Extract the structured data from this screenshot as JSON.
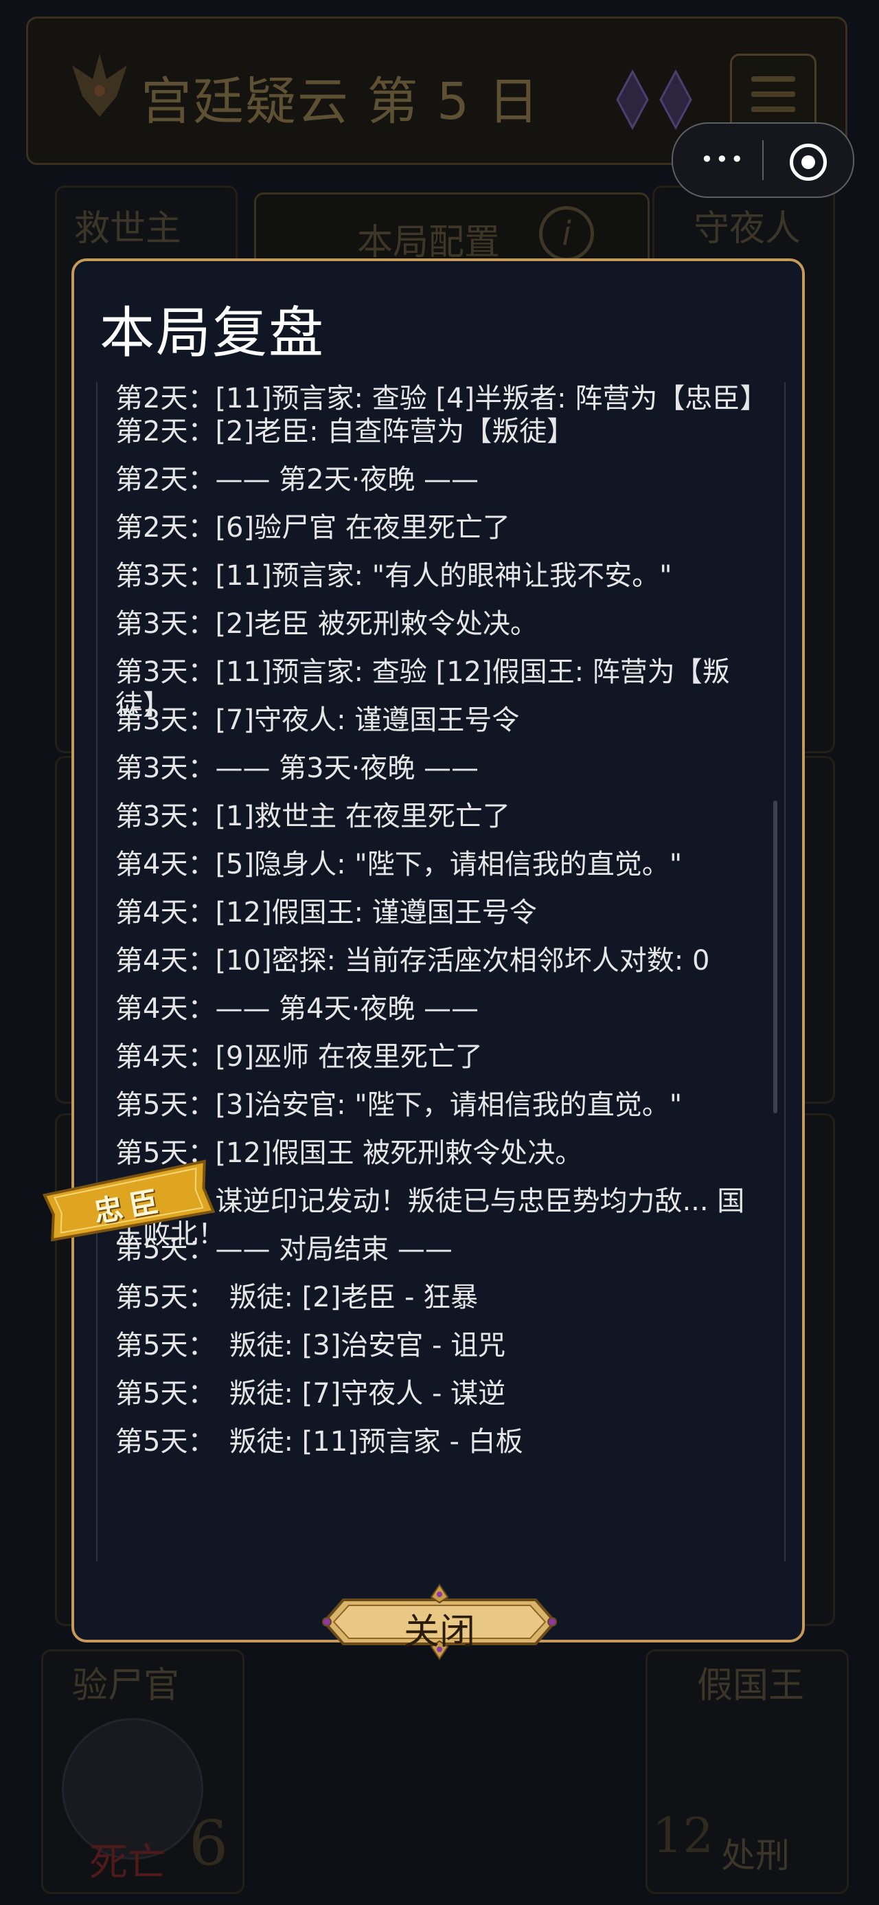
{
  "game": {
    "title": "宫廷疑云 第 5 日"
  },
  "board": {
    "seats": [
      "救世主",
      "守夜人",
      "验尸官",
      "假国王"
    ],
    "config_label": "本局配置",
    "info_icon": "i",
    "dead_label": "死亡",
    "seat_number_left": "6",
    "seat_number_right": "12",
    "seat_status_right": "处刑"
  },
  "modal": {
    "title": "本局复盘",
    "close_label": "关闭",
    "badge_label": "忠臣",
    "log": [
      "第2天：[11]预言家: 查验 [4]半叛者: 阵营为【忠臣】",
      "第2天：[2]老臣: 自查阵营为【叛徒】",
      "第2天：—— 第2天·夜晚 ——",
      "第2天：[6]验尸官 在夜里死亡了",
      "第3天：[11]预言家: \"有人的眼神让我不安。\"",
      "第3天：[2]老臣 被死刑敕令处决。",
      "第3天：[11]预言家: 查验 [12]假国王: 阵营为【叛徒】",
      "第3天：[7]守夜人: 谨遵国王号令",
      "第3天：—— 第3天·夜晚 ——",
      "第3天：[1]救世主 在夜里死亡了",
      "第4天：[5]隐身人: \"陛下，请相信我的直觉。\"",
      "第4天：[12]假国王: 谨遵国王号令",
      "第4天：[10]密探: 当前存活座次相邻坏人对数: 0",
      "第4天：—— 第4天·夜晚 ——",
      "第4天：[9]巫师 在夜里死亡了",
      "第5天：[3]治安官: \"陛下，请相信我的直觉。\"",
      "第5天：[12]假国王 被死刑敕令处决。",
      "第5天：谋逆印记发动！叛徒已与忠臣势均力敌... 国王败北！",
      "第5天：—— 对局结束 ——",
      "第5天：　叛徒: [2]老臣 - 狂暴",
      "第5天：　叛徒: [3]治安官 - 诅咒",
      "第5天：　叛徒: [7]守夜人 - 谋逆",
      "第5天：　叛徒: [11]预言家 - 白板"
    ]
  },
  "colors": {
    "modal_bg": "#111624",
    "modal_border": "#c59a5a",
    "button_gold": "#d9b46a",
    "badge_gold": "#e0a520"
  },
  "icons": {
    "crest": "trident-crest-icon",
    "gems": "purple-gem-icon",
    "menu": "hamburger-menu-icon",
    "capsule_more": "more-dots-icon",
    "capsule_close": "target-circle-icon"
  }
}
